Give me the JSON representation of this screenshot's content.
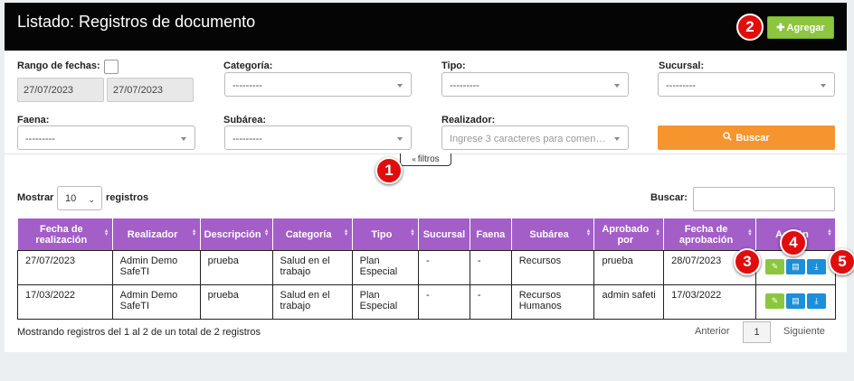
{
  "header": {
    "title": "Listado: Registros de documento",
    "add_label": "Agregar"
  },
  "filters": {
    "date_range_label": "Rango de fechas:",
    "date_from": "27/07/2023",
    "date_to": "27/07/2023",
    "categoria_label": "Categoría:",
    "categoria_value": "---------",
    "tipo_label": "Tipo:",
    "tipo_value": "---------",
    "sucursal_label": "Sucursal:",
    "sucursal_value": "---------",
    "faena_label": "Faena:",
    "faena_value": "---------",
    "subarea_label": "Subárea:",
    "subarea_value": "---------",
    "realizador_label": "Realizador:",
    "realizador_placeholder": "Ingrese 3 caracteres para comen…",
    "search_label": "Buscar",
    "toggle_label": "filtros"
  },
  "table_controls": {
    "show_label": "Mostrar",
    "page_length": "10",
    "records_label": "registros",
    "search_label": "Buscar:"
  },
  "columns": [
    "Fecha de realización",
    "Realizador",
    "Descripción",
    "Categoría",
    "Tipo",
    "Sucursal",
    "Faena",
    "Subárea",
    "Aprobado por",
    "Fecha de aprobación",
    "Acción"
  ],
  "rows": [
    {
      "fecha": "27/07/2023",
      "realizador": "Admin Demo SafeTI",
      "descripcion": "prueba",
      "categoria": "Salud en el trabajo",
      "tipo": "Plan Especial",
      "sucursal": "-",
      "faena": "-",
      "subarea": "Recursos",
      "aprobado": "prueba",
      "fecha_aprob": "28/07/2023"
    },
    {
      "fecha": "17/03/2022",
      "realizador": "Admin Demo SafeTI",
      "descripcion": "prueba",
      "categoria": "Salud en el trabajo",
      "tipo": "Plan Especial",
      "sucursal": "-",
      "faena": "-",
      "subarea": "Recursos Humanos",
      "aprobado": "admin safeti",
      "fecha_aprob": "17/03/2022"
    }
  ],
  "footer": {
    "info": "Mostrando registros del 1 al 2 de un total de 2 registros",
    "prev": "Anterior",
    "page": "1",
    "next": "Siguiente"
  },
  "badges": [
    "1",
    "2",
    "3",
    "4",
    "5"
  ],
  "icons": {
    "add": "plus-icon",
    "search": "search-icon",
    "toggle": "chevron-up-icon",
    "edit": "pencil-icon",
    "document": "document-icon",
    "download": "download-icon"
  },
  "colors": {
    "header_bg": "#050505",
    "add_button": "#8cc63f",
    "search_button": "#f6952e",
    "table_header": "#a35ec8",
    "action_blue": "#1b8fd8",
    "badge": "#e10d0d"
  }
}
